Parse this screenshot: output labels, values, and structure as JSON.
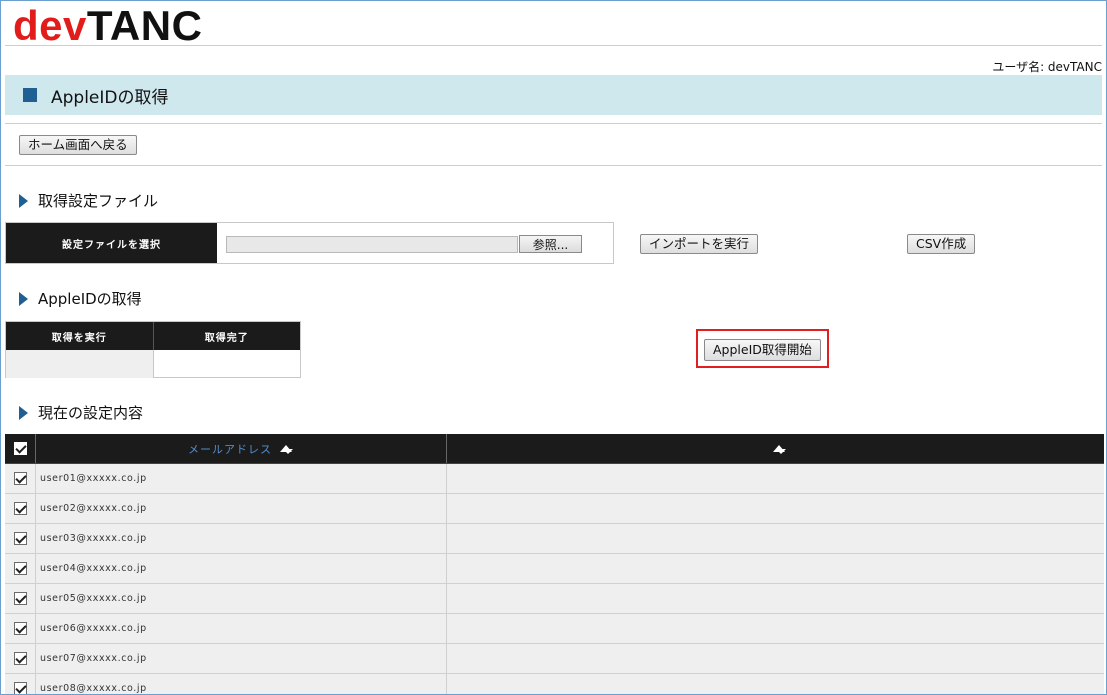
{
  "header": {
    "logo_dev": "dev",
    "logo_tanc": "TANC",
    "username": "ユーザ名: devTANC"
  },
  "page": {
    "title": "AppleIDの取得",
    "home_button": "ホーム画面へ戻る"
  },
  "settings_file": {
    "heading": "取得設定ファイル",
    "select_label": "設定ファイルを選択",
    "file_value": "",
    "browse_button": "参照...",
    "import_button": "インポートを実行",
    "csv_button": "CSV作成"
  },
  "apple_id": {
    "heading": "AppleIDの取得",
    "col_execute": "取得を実行",
    "col_done": "取得完了",
    "start_button": "AppleID取得開始"
  },
  "current": {
    "heading": "現在の設定内容",
    "col_email": "メールアドレス",
    "col_second": "",
    "rows": [
      {
        "email": "user01@xxxxx.co.jp",
        "checked": true
      },
      {
        "email": "user02@xxxxx.co.jp",
        "checked": true
      },
      {
        "email": "user03@xxxxx.co.jp",
        "checked": true
      },
      {
        "email": "user04@xxxxx.co.jp",
        "checked": true
      },
      {
        "email": "user05@xxxxx.co.jp",
        "checked": true
      },
      {
        "email": "user06@xxxxx.co.jp",
        "checked": true
      },
      {
        "email": "user07@xxxxx.co.jp",
        "checked": true
      },
      {
        "email": "user08@xxxxx.co.jp",
        "checked": true
      }
    ]
  },
  "colors": {
    "logo_red": "#e21b1b",
    "title_bar_bg": "#cfe8ee",
    "accent_blue": "#1f5f93",
    "highlight_red": "#e02020",
    "header_dark": "#1b1b1b"
  }
}
